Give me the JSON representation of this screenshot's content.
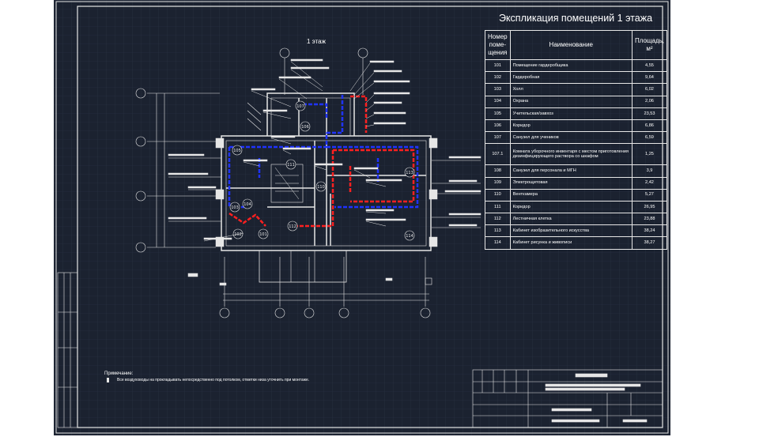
{
  "floor_plan": {
    "title": "1 этаж"
  },
  "explication": {
    "title": "Экспликация помещений 1 этажа",
    "headers": {
      "number": "Номер поме-щения",
      "name": "Наименование",
      "area": "Площадь, м²"
    },
    "rows": [
      {
        "num": "101",
        "name": "Помещение гардеробщика",
        "area": "4,55"
      },
      {
        "num": "102",
        "name": "Гардеробная",
        "area": "9,64"
      },
      {
        "num": "103",
        "name": "Холл",
        "area": "6,02"
      },
      {
        "num": "104",
        "name": "Охрана",
        "area": "2,06"
      },
      {
        "num": "105",
        "name": "Учительская/завхоз",
        "area": "23,53"
      },
      {
        "num": "106",
        "name": "Коридор",
        "area": "6,86"
      },
      {
        "num": "107",
        "name": "Санузел для учеников",
        "area": "6,59"
      },
      {
        "num": "107.1",
        "name": "Комната уборочного инвентаря с местом приготовления дезинфицирующего раствора со шкафом",
        "area": "1,25"
      },
      {
        "num": "108",
        "name": "Санузел для персонала и МГН",
        "area": "3,9"
      },
      {
        "num": "109",
        "name": "Электрощитовая",
        "area": "2,42"
      },
      {
        "num": "110",
        "name": "Венткамера",
        "area": "5,27"
      },
      {
        "num": "111",
        "name": "Коридор",
        "area": "26,95"
      },
      {
        "num": "112",
        "name": "Лестничная клетка",
        "area": "23,88"
      },
      {
        "num": "113",
        "name": "Кабинет изобразительного искусства",
        "area": "38,24"
      },
      {
        "num": "114",
        "name": "Кабинет рисунка и живописи",
        "area": "38,27"
      }
    ]
  },
  "note": {
    "title": "Примечание:",
    "text": "Все воздуховоды на прокладывать непосредственно под потолком, отметки низа уточнить при монтаже."
  },
  "colors": {
    "background": "#1b2230",
    "supply_duct": "#1f33ff",
    "exhaust_duct": "#ff2020",
    "lines": "#e6e6e6"
  }
}
